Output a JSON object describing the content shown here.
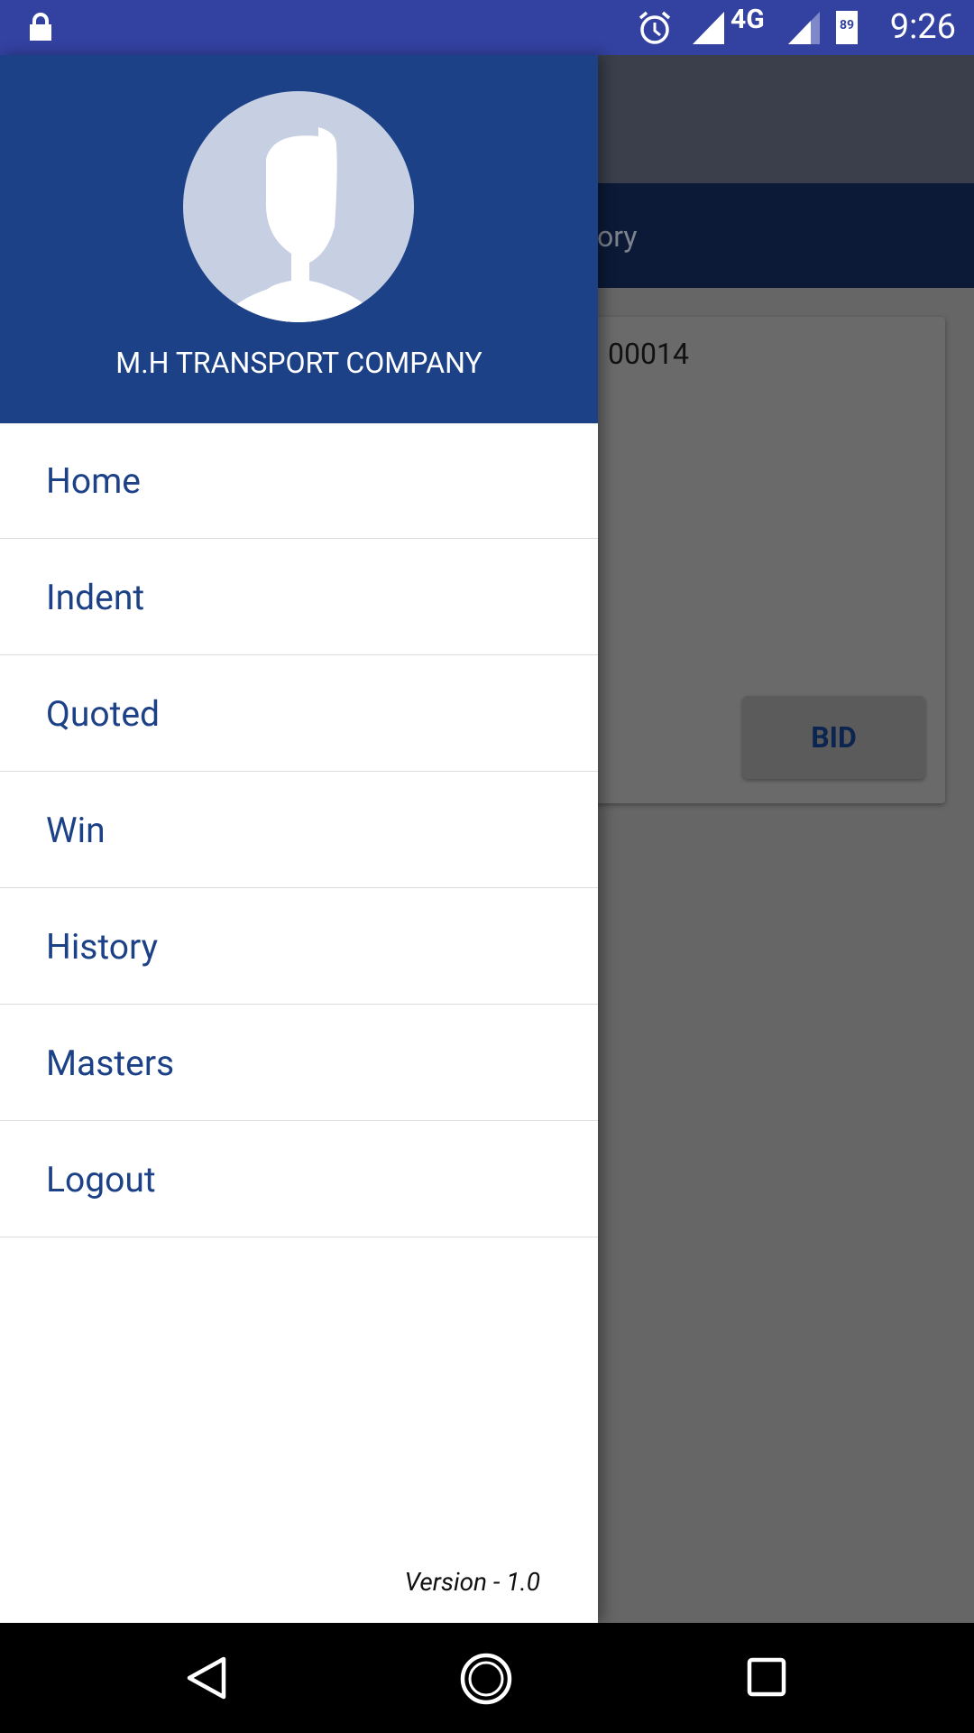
{
  "status_bar": {
    "time": "9:26",
    "network": "4G",
    "battery": "89",
    "icons": [
      "lock-icon",
      "alarm-icon",
      "signal-icon",
      "signal-icon-2",
      "battery-icon"
    ],
    "color": "#3341a0"
  },
  "background": {
    "tab_text": "ory",
    "card_id": "00014",
    "bid_label": "BID"
  },
  "drawer": {
    "company_name": "M.H TRANSPORT COMPANY",
    "header_color": "#1c4187",
    "items": [
      {
        "label": "Home"
      },
      {
        "label": "Indent"
      },
      {
        "label": "Quoted"
      },
      {
        "label": "Win"
      },
      {
        "label": "History"
      },
      {
        "label": "Masters"
      },
      {
        "label": "Logout"
      }
    ],
    "version": "Version - 1.0"
  },
  "nav_bar": {
    "icons": [
      "back-icon",
      "home-icon",
      "recents-icon"
    ]
  }
}
